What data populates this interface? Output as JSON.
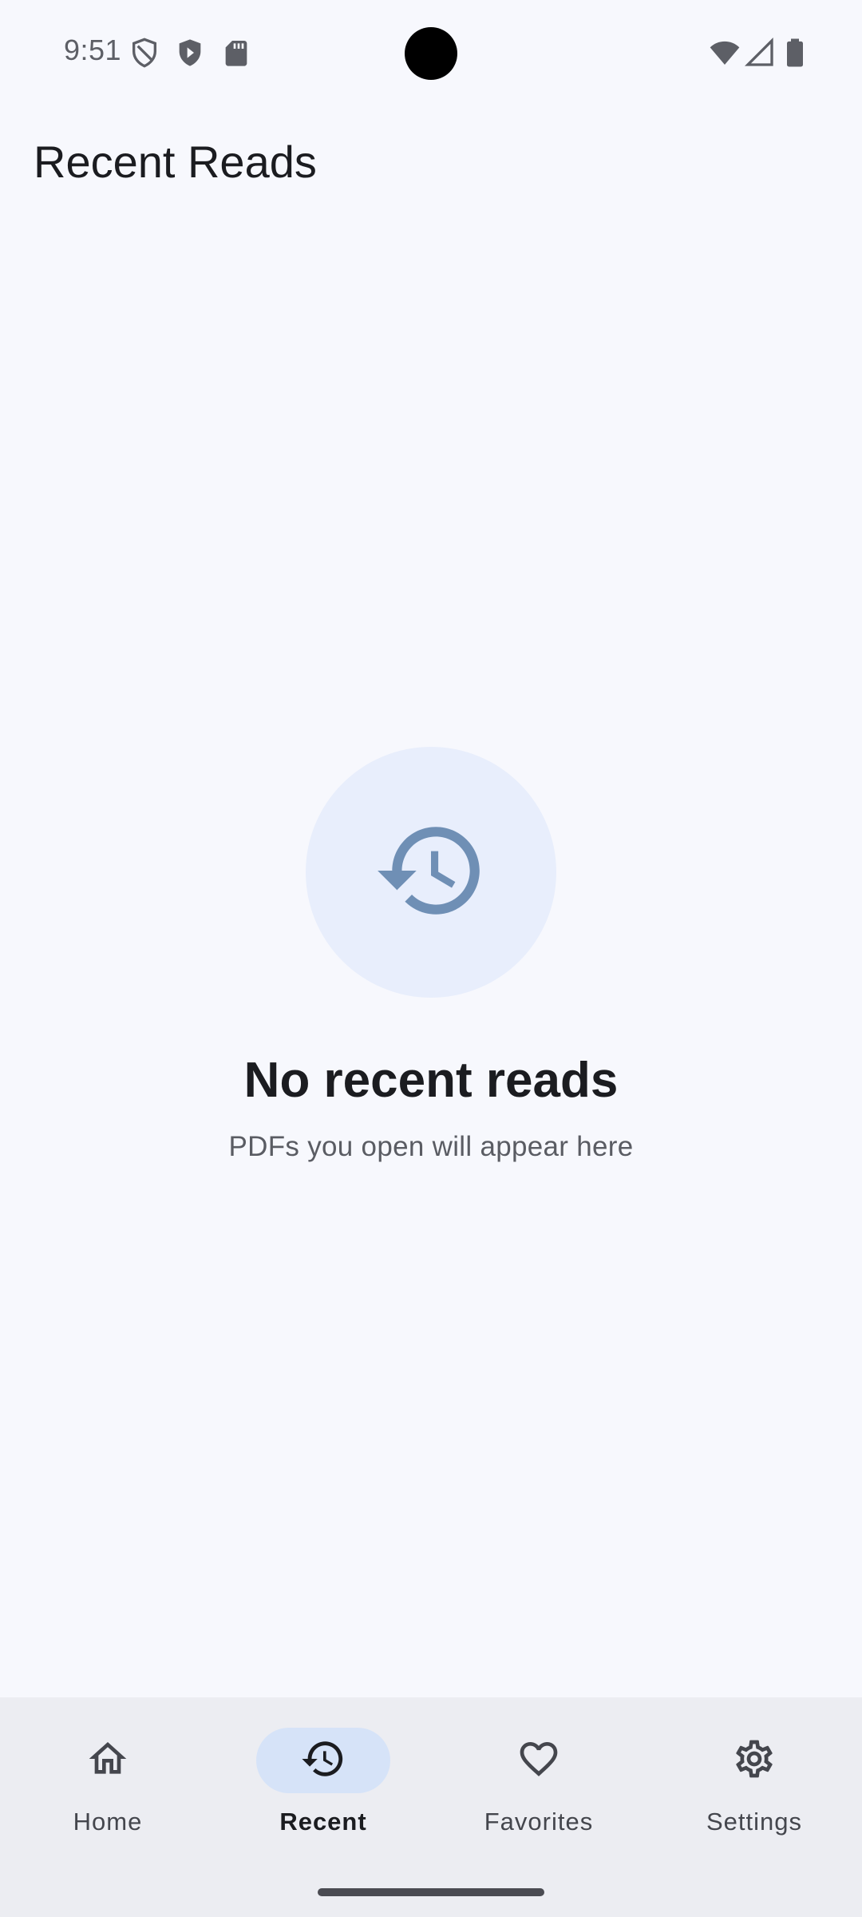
{
  "status_bar": {
    "time": "9:51",
    "left_icons": [
      "shield-outline-icon",
      "shield-play-icon",
      "sd-card-icon"
    ],
    "right_icons": [
      "wifi-icon",
      "cellular-signal-icon",
      "battery-icon"
    ]
  },
  "app_bar": {
    "title": "Recent Reads"
  },
  "empty_state": {
    "icon": "history-icon",
    "title": "No recent reads",
    "subtitle": "PDFs you open will appear here"
  },
  "bottom_nav": {
    "items": [
      {
        "label": "Home",
        "icon": "home-icon",
        "selected": false
      },
      {
        "label": "Recent",
        "icon": "history-icon",
        "selected": true
      },
      {
        "label": "Favorites",
        "icon": "heart-icon",
        "selected": false
      },
      {
        "label": "Settings",
        "icon": "gear-icon",
        "selected": false
      }
    ]
  },
  "colors": {
    "background": "#f7f8fd",
    "nav_background": "#ecedf2",
    "active_pill": "#d6e3f8",
    "empty_icon_circle": "#e8eefc",
    "empty_icon": "#6f8fb5"
  }
}
